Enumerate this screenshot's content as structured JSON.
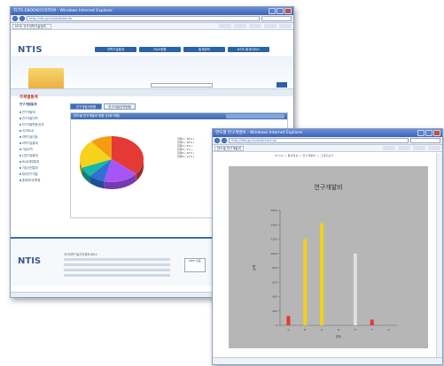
{
  "window_a": {
    "title": "TCTS EBOOK/SYSTEM - Windows Internet Explorer",
    "address": "http://ntis.go.kr/stat/stat.do",
    "tab_label": "NTIS 국가과학기술정보...",
    "logo_text": "NTIS",
    "top_nav": [
      "과학기술통계",
      "R&D현황",
      "통계정보",
      "NTIS 통계서비스"
    ],
    "left_nav": {
      "heading": "주제별통계",
      "sub_heading": "연구개발통계",
      "items": [
        "연구개발비",
        "연구개발인력",
        "연구개발활동/성과",
        "국가R&D",
        "과학기술지표",
        "과학기술통계",
        "기술무역",
        "산업기술통계",
        "R&D세부통계",
        "기술이전통계",
        "정부연구개발",
        "통계데이터활용"
      ]
    },
    "content_tabs": [
      "연구개발비현황",
      "연구개발인력현황"
    ],
    "panel_title": "연도별 연구개발비 현황 (단위:억원)",
    "group_label": "전체",
    "chart_data": {
      "type": "pie",
      "title": "",
      "categories": [
        "항목1",
        "항목2",
        "항목3",
        "항목4",
        "항목5",
        "항목6"
      ],
      "values": [
        36,
        18,
        8,
        7,
        20,
        11
      ],
      "colors": [
        "#e53935",
        "#a855f7",
        "#2f6fd6",
        "#17b8a6",
        "#f7d21b",
        "#f39c12"
      ]
    },
    "legend_entries": [
      "항목1 ( 36% )",
      "항목2 ( 18% )",
      "항목3 ( 8% )",
      "항목4 ( 7% )",
      "항목5 ( 20% )",
      "항목6 ( 11% )"
    ],
    "footer": {
      "logo_text": "NTIS",
      "org": "국가과학기술지식정보서비스",
      "badge": "NTIS 인증"
    }
  },
  "window_b": {
    "title": "연도별 연구개발비 - Windows Internet Explorer",
    "address": "http://ntis.go.kr/stat/chart.do",
    "tab_label": "연도별 연구개발비",
    "breadcrumb": "Home > 통계정보 > 연구개발비 > 그래프보기",
    "chart_data": {
      "type": "bar",
      "title": "연구개발비",
      "categories": [
        "A",
        "B",
        "C",
        "D",
        "E",
        "F",
        "G"
      ],
      "values": [
        130,
        1200,
        1420,
        0,
        1000,
        80,
        0
      ],
      "colors": [
        "#e53935",
        "#f2d01c",
        "#f2d01c",
        "#e53935",
        "#e0e0e0",
        "#e53935",
        "#e53935"
      ],
      "ylim": [
        0,
        1600
      ],
      "ylabel": "금액",
      "xlabel": "연도"
    }
  }
}
